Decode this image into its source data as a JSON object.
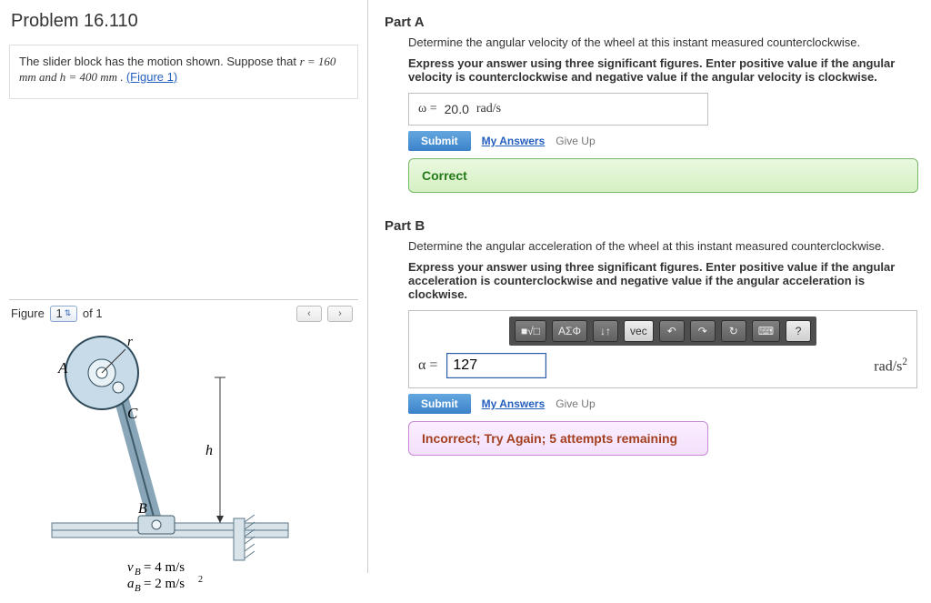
{
  "problem": {
    "title": "Problem 16.110",
    "statement_prefix": "The slider block has the motion shown. Suppose that ",
    "statement_params": "r = 160  mm and h = 400  mm . ",
    "figure_link": "(Figure 1)"
  },
  "figure": {
    "label": "Figure",
    "current": "1",
    "of_label": "of 1",
    "labels": {
      "A": "A",
      "B": "B",
      "C": "C",
      "r": "r",
      "h": "h"
    },
    "vb": "v_B = 4 m/s",
    "ab": "a_B = 2 m/s²"
  },
  "partA": {
    "title": "Part A",
    "prompt": "Determine the angular velocity of the wheel at this instant measured counterclockwise.",
    "instruction": "Express your answer using three significant figures. Enter positive value if the angular velocity is counterclockwise and negative value if the angular velocity is clockwise.",
    "var": "ω =",
    "value": "20.0",
    "unit": "rad/s",
    "submit": "Submit",
    "my_answers": "My Answers",
    "give_up": "Give Up",
    "feedback": "Correct"
  },
  "partB": {
    "title": "Part B",
    "prompt": "Determine the angular acceleration of the wheel at this instant measured counterclockwise.",
    "instruction": "Express your answer using three significant figures. Enter positive value if the angular acceleration is counterclockwise and negative value if the angular acceleration is clockwise.",
    "toolbar": {
      "templates": "■√□",
      "greek": "ΑΣΦ",
      "sort": "↓↑",
      "vec": "vec",
      "undo": "↶",
      "redo": "↷",
      "reset": "↻",
      "keyboard": "⌨",
      "help": "?"
    },
    "var": "α =",
    "value": "127",
    "unit": "rad/s",
    "submit": "Submit",
    "my_answers": "My Answers",
    "give_up": "Give Up",
    "feedback": "Incorrect; Try Again; 5 attempts remaining"
  }
}
